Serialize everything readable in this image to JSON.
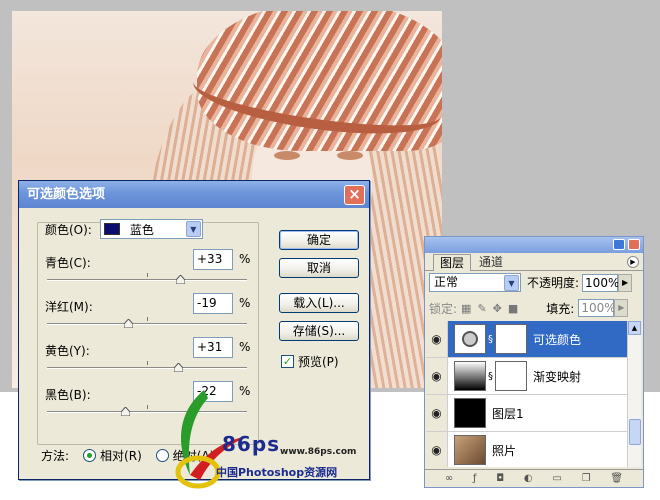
{
  "dialog": {
    "title": "可选颜色选项",
    "close_label": "×",
    "colors_label": "颜色(O):",
    "colors_value": "蓝色",
    "sliders": [
      {
        "label": "青色(C):",
        "value": "+33",
        "unit": "%",
        "level_percent": 33
      },
      {
        "label": "洋红(M):",
        "value": "-19",
        "unit": "%",
        "level_percent": -19
      },
      {
        "label": "黄色(Y):",
        "value": "+31",
        "unit": "%",
        "level_percent": 31
      },
      {
        "label": "黑色(B):",
        "value": "-22",
        "unit": "%",
        "level_percent": -22
      }
    ],
    "buttons": {
      "ok": "确定",
      "cancel": "取消",
      "load": "载入(L)...",
      "save": "存储(S)..."
    },
    "preview_label": "预览(P)",
    "preview_checked": true,
    "method_label": "方法:",
    "method_relative": "相对(R)",
    "method_absolute": "绝对(A)",
    "method_selected": "relative"
  },
  "watermark": {
    "number": "86ps",
    "url": "www.86ps.com",
    "cn_text": "中国Photoshop资源网"
  },
  "layers_panel": {
    "tab_layers": "图层",
    "tab_channels": "通道",
    "blend_mode": "正常",
    "opacity_label": "不透明度:",
    "opacity_value": "100%",
    "lock_label": "锁定:",
    "fill_label": "填充:",
    "fill_value": "100%",
    "layers": [
      {
        "name": "可选颜色",
        "active": true
      },
      {
        "name": "渐变映射",
        "active": false
      },
      {
        "name": "图层1",
        "active": false
      },
      {
        "name": "照片",
        "active": false
      }
    ]
  }
}
